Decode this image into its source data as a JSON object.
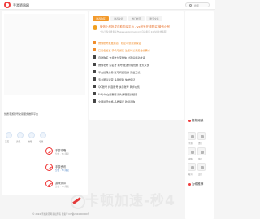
{
  "header": {
    "site_name": "手游资讯网",
    "search_placeholder": "搜索"
  },
  "left": {
    "intro_line": "优质手游账号交易服务推荐平台",
    "icons": [
      {
        "label": "首页"
      },
      {
        "label": "资讯"
      },
      {
        "label": "攻略"
      },
      {
        "label": "专题"
      }
    ],
    "channels": [
      {
        "title": "手游攻略",
        "meta": "分类 · 7k 阅读"
      },
      {
        "title": "手游资讯",
        "meta": "分类 · 7k 阅读"
      },
      {
        "title": "游戏测评",
        "meta": "分类 · 7k 阅读"
      }
    ]
  },
  "main": {
    "tabs": [
      {
        "label": "推荐购买"
      },
      {
        "label": "推荐交易"
      },
      {
        "label": "热门帐号"
      },
      {
        "label": "账号交易"
      }
    ],
    "notice": {
      "title": "微信小号批发自助购买平台 - vx账号在线购买(微信小号",
      "subtitle": "个人号专业批发平台 www.weixinhao.com 自动发货 24小时在线客服"
    },
    "features": [
      {
        "text": "微信账号批发渠道，稳定可靠货源保证",
        "accent": true
      },
      {
        "text": "已实名验证 手机号绑定 注册时长满足各类需求",
        "accent": true
      },
      {
        "text": "自助购买 支持支付宝微信 付款后自动发货",
        "accent": false
      },
      {
        "text": "微信老号 实名号 新号 批发价格优惠 量大从优",
        "accent": false
      },
      {
        "text": "平台担保交易 账号问题包换 售后无忧",
        "accent": false
      },
      {
        "text": "专业团队运营 多年经验 信誉保证",
        "accent": false
      },
      {
        "text": "QQ账号 抖音账号 快手账号 同步在售",
        "accent": false
      },
      {
        "text": "24小时在线客服 随时解答您的疑问",
        "accent": false
      },
      {
        "text": "全网最低价格 品质保证 欢迎选购",
        "accent": false
      }
    ]
  },
  "side": {
    "hot_title": "推荐阅读",
    "thumbs": [
      {
        "label": "手游"
      },
      {
        "label": "资讯"
      },
      {
        "label": "攻略"
      },
      {
        "label": "游戏"
      },
      {
        "label": "帐号"
      },
      {
        "label": "交易"
      }
    ],
    "recommend_title": "为你推荐"
  },
  "watermark": {
    "text": "卡顿加速-秒4"
  },
  "footer": {
    "text": "© 2024 手游资讯网 版权所有 备案号 ICP备2024000000号"
  },
  "colors": {
    "accent_orange": "#f39a2c",
    "brand_red": "#f03c3c",
    "link_blue": "#4b82c5"
  }
}
